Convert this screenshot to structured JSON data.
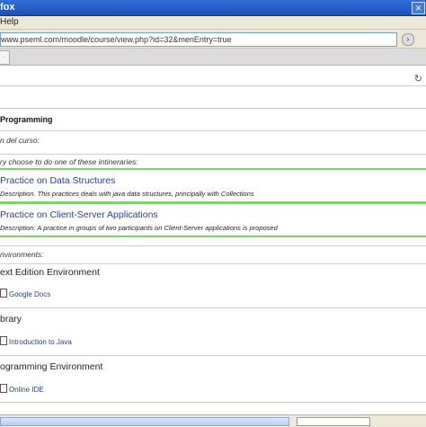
{
  "window": {
    "title": "fox"
  },
  "menu": {
    "help_label": "Help"
  },
  "address": {
    "url": "www.pseml.com/moodle/course/view.php?id=32&menEntry=true",
    "go_label": "›"
  },
  "course": {
    "title": "Programming",
    "intro_line": "n del curso:",
    "choose_line": "ry choose to do one of these intineraries:"
  },
  "options": [
    {
      "title": "Practice on Data Structures",
      "description": "Description. This practices deals with java data structures, principally with Collections"
    },
    {
      "title": "Practice on Client-Server Applications",
      "description": "Description: A practice in groups of two participants on Client-Server applications is proposed"
    }
  ],
  "environments_label": "nvironments:",
  "sections": [
    {
      "title": "ext Edition Environment",
      "resource": "Google Docs"
    },
    {
      "title": "brary",
      "resource": "Introduction to Java"
    },
    {
      "title": "ogramming Environment",
      "resource": "Online IDE"
    }
  ],
  "status": {
    "progress_fraction": 0.0
  }
}
